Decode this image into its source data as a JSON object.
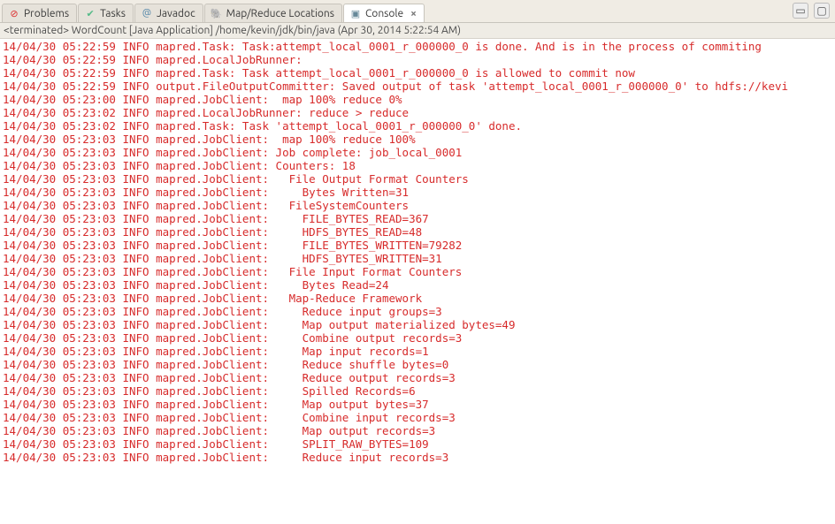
{
  "tabs": [
    {
      "label": "Problems"
    },
    {
      "label": "Tasks"
    },
    {
      "label": "Javadoc"
    },
    {
      "label": "Map/Reduce Locations"
    },
    {
      "label": "Console"
    }
  ],
  "info": {
    "status": "<terminated>",
    "app": "WordCount [Java Application]",
    "cmd": "/home/kevin/jdk/bin/java",
    "date": "(Apr 30, 2014 5:22:54 AM)"
  },
  "log": [
    "14/04/30 05:22:59 INFO mapred.Task: Task:attempt_local_0001_r_000000_0 is done. And is in the process of commiting",
    "14/04/30 05:22:59 INFO mapred.LocalJobRunner:",
    "14/04/30 05:22:59 INFO mapred.Task: Task attempt_local_0001_r_000000_0 is allowed to commit now",
    "14/04/30 05:22:59 INFO output.FileOutputCommitter: Saved output of task 'attempt_local_0001_r_000000_0' to hdfs://kevi",
    "14/04/30 05:23:00 INFO mapred.JobClient:  map 100% reduce 0%",
    "14/04/30 05:23:02 INFO mapred.LocalJobRunner: reduce > reduce",
    "14/04/30 05:23:02 INFO mapred.Task: Task 'attempt_local_0001_r_000000_0' done.",
    "14/04/30 05:23:03 INFO mapred.JobClient:  map 100% reduce 100%",
    "14/04/30 05:23:03 INFO mapred.JobClient: Job complete: job_local_0001",
    "14/04/30 05:23:03 INFO mapred.JobClient: Counters: 18",
    "14/04/30 05:23:03 INFO mapred.JobClient:   File Output Format Counters ",
    "14/04/30 05:23:03 INFO mapred.JobClient:     Bytes Written=31",
    "14/04/30 05:23:03 INFO mapred.JobClient:   FileSystemCounters",
    "14/04/30 05:23:03 INFO mapred.JobClient:     FILE_BYTES_READ=367",
    "14/04/30 05:23:03 INFO mapred.JobClient:     HDFS_BYTES_READ=48",
    "14/04/30 05:23:03 INFO mapred.JobClient:     FILE_BYTES_WRITTEN=79282",
    "14/04/30 05:23:03 INFO mapred.JobClient:     HDFS_BYTES_WRITTEN=31",
    "14/04/30 05:23:03 INFO mapred.JobClient:   File Input Format Counters ",
    "14/04/30 05:23:03 INFO mapred.JobClient:     Bytes Read=24",
    "14/04/30 05:23:03 INFO mapred.JobClient:   Map-Reduce Framework",
    "14/04/30 05:23:03 INFO mapred.JobClient:     Reduce input groups=3",
    "14/04/30 05:23:03 INFO mapred.JobClient:     Map output materialized bytes=49",
    "14/04/30 05:23:03 INFO mapred.JobClient:     Combine output records=3",
    "14/04/30 05:23:03 INFO mapred.JobClient:     Map input records=1",
    "14/04/30 05:23:03 INFO mapred.JobClient:     Reduce shuffle bytes=0",
    "14/04/30 05:23:03 INFO mapred.JobClient:     Reduce output records=3",
    "14/04/30 05:23:03 INFO mapred.JobClient:     Spilled Records=6",
    "14/04/30 05:23:03 INFO mapred.JobClient:     Map output bytes=37",
    "14/04/30 05:23:03 INFO mapred.JobClient:     Combine input records=3",
    "14/04/30 05:23:03 INFO mapred.JobClient:     Map output records=3",
    "14/04/30 05:23:03 INFO mapred.JobClient:     SPLIT_RAW_BYTES=109",
    "14/04/30 05:23:03 INFO mapred.JobClient:     Reduce input records=3"
  ]
}
